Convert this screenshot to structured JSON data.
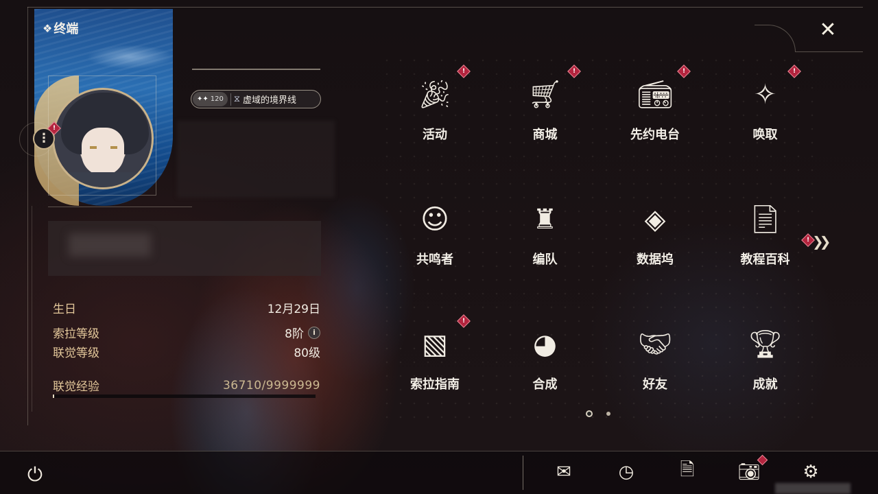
{
  "window": {
    "title": "终端"
  },
  "profile": {
    "title_badge": {
      "level": "120",
      "name": "虚域的境界线"
    }
  },
  "stats": [
    {
      "label": "生日",
      "value": "12月29日"
    },
    {
      "label": "索拉等级",
      "value": "8阶"
    },
    {
      "label": "联觉等级",
      "value": "80级"
    }
  ],
  "experience": {
    "label": "联觉经验",
    "value": "36710/9999999",
    "progress": 0.0037
  },
  "menu": [
    {
      "id": "events",
      "label": "活动",
      "icon": "events-icon",
      "alert": true
    },
    {
      "id": "shop",
      "label": "商城",
      "icon": "shop-cart-icon",
      "alert": true
    },
    {
      "id": "pioneer-radio",
      "label": "先约电台",
      "icon": "radio-record-icon",
      "alert": true
    },
    {
      "id": "convene",
      "label": "唤取",
      "icon": "convene-compass-icon",
      "alert": true
    },
    {
      "id": "resonators",
      "label": "共鸣者",
      "icon": "resonator-head-icon",
      "alert": false
    },
    {
      "id": "team",
      "label": "编队",
      "icon": "team-chess-icon",
      "alert": false
    },
    {
      "id": "data-bank",
      "label": "数据坞",
      "icon": "data-bank-icon",
      "alert": false
    },
    {
      "id": "tutorial",
      "label": "教程百科",
      "icon": "tutorial-doc-icon",
      "alert": false
    },
    {
      "id": "guidebook",
      "label": "索拉指南",
      "icon": "guidebook-compass-icon",
      "alert": true
    },
    {
      "id": "synthesis",
      "label": "合成",
      "icon": "synthesis-orbs-icon",
      "alert": false
    },
    {
      "id": "friends",
      "label": "好友",
      "icon": "handshake-icon",
      "alert": false
    },
    {
      "id": "achievements",
      "label": "成就",
      "icon": "trophy-icon",
      "alert": false
    }
  ],
  "pagination": {
    "current": 1,
    "total": 2
  },
  "bottom_bar": [
    {
      "id": "mail",
      "icon": "mail-icon",
      "alert": false
    },
    {
      "id": "event-timer",
      "icon": "clock-icon",
      "alert": false
    },
    {
      "id": "notice",
      "icon": "notice-icon",
      "alert": false
    },
    {
      "id": "photo",
      "icon": "camera-icon",
      "alert": true
    },
    {
      "id": "settings",
      "icon": "gear-icon",
      "alert": false
    }
  ],
  "colors": {
    "accent_gold": "#e3c79a",
    "alert_red": "#b3243e",
    "text_light": "#f1ece3"
  }
}
